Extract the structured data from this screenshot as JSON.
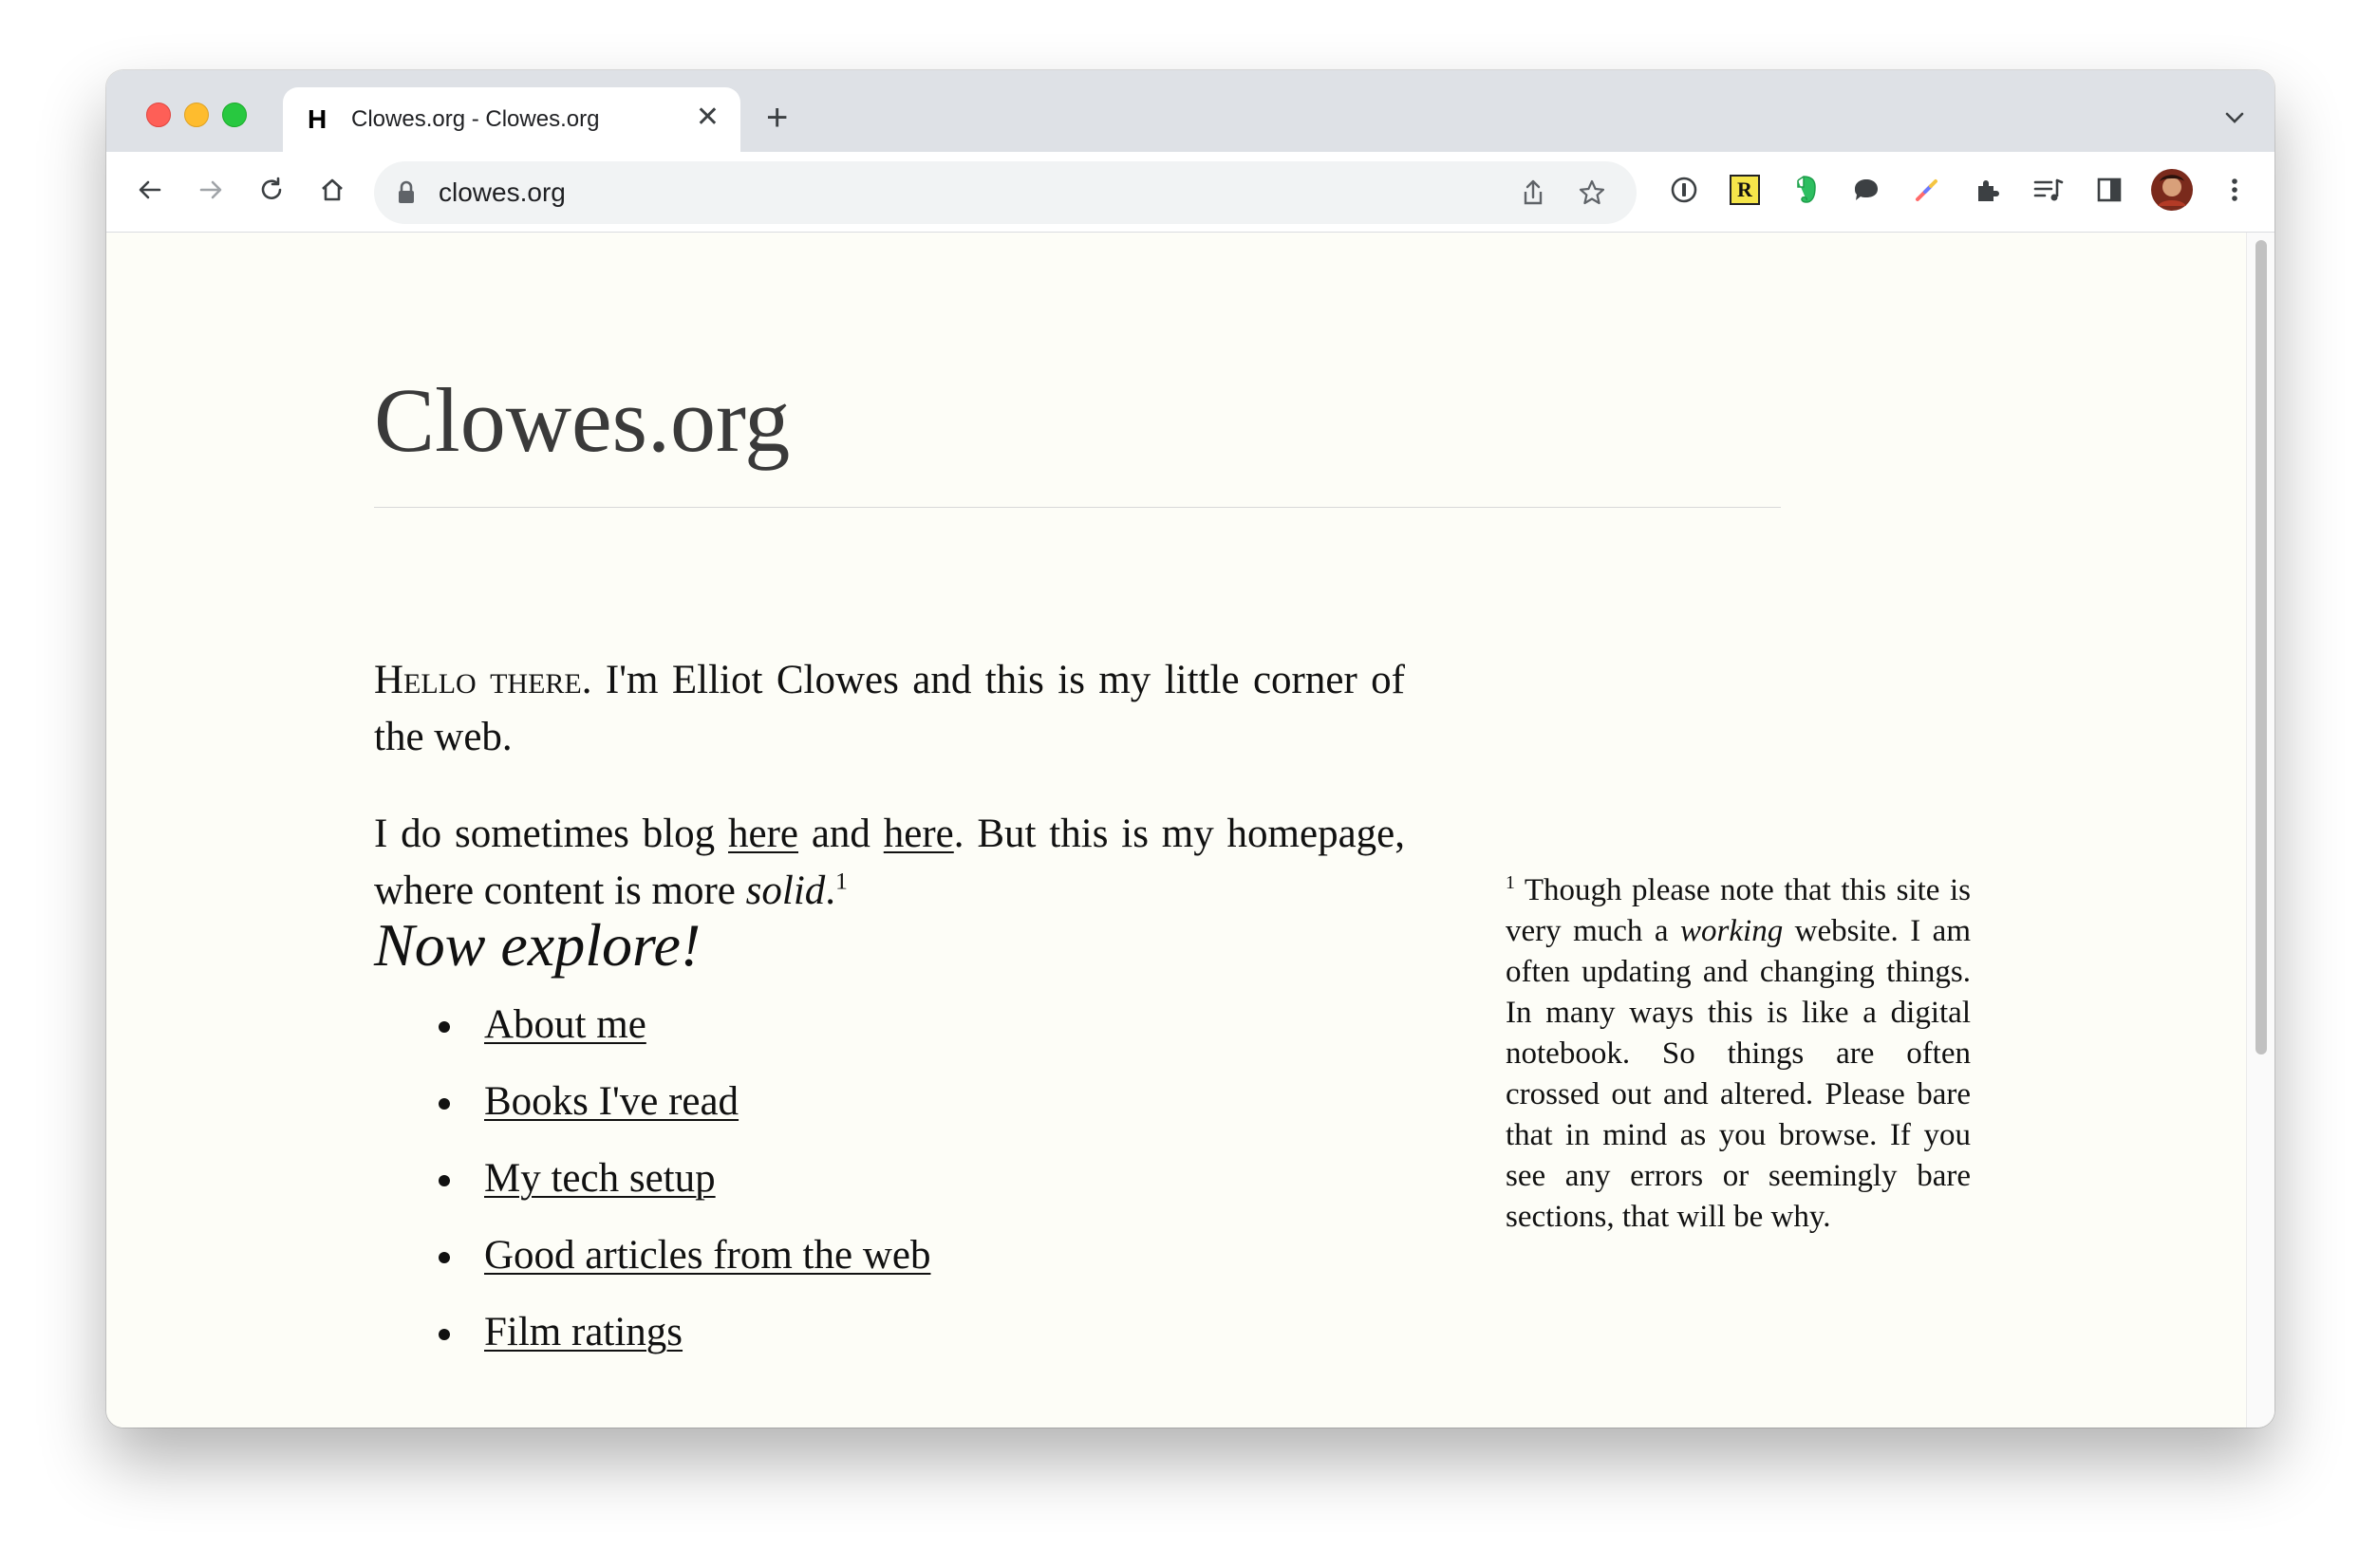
{
  "browser": {
    "tab": {
      "favicon": "H",
      "title": "Clowes.org - Clowes.org",
      "close": "✕"
    },
    "new_tab": "+",
    "tab_menu": "⌄",
    "address": "clowes.org",
    "icons": [
      "back-icon",
      "forward-icon",
      "reload-icon",
      "home-icon",
      "lock-icon",
      "share-icon",
      "bookmark-star-icon",
      "onepassword-icon",
      "readwise-icon",
      "evernote-icon",
      "chat-icon",
      "color-picker-icon",
      "extensions-icon",
      "reading-list-icon",
      "side-panel-icon",
      "profile-avatar",
      "more-menu-icon"
    ],
    "readwise_label": "R"
  },
  "page": {
    "title": "Clowes.org",
    "intro": {
      "lead": "Hello there.",
      "text": " I'm Elliot Clowes and this is my little corner of the web."
    },
    "blog": {
      "t1": "I do sometimes blog ",
      "link1": "here",
      "t2": " and ",
      "link2": "here",
      "t3": ". But this is my homepage, where content is more ",
      "emph": "solid",
      "t4": ".",
      "ref": "1"
    },
    "explore_heading": "Now explore!",
    "links": [
      {
        "label": "About me"
      },
      {
        "label": "Books I've read"
      },
      {
        "label": "My tech setup"
      },
      {
        "label": "Good articles from the web"
      },
      {
        "label": "Film ratings"
      }
    ],
    "sidenote": {
      "ref": "1",
      "t1": " Though please note that this site is very much a ",
      "emph": "working",
      "t2": " website. I am often updating and changing things. In many ways this is like a digital notebook. So things are often crossed out and altered. Please bare that in mind as you browse. If you see any errors or seemingly bare sections, that will be why."
    }
  },
  "colors": {
    "page_background": "#fdfdf7",
    "tabstrip": "#dee1e6",
    "close_light": "#fe5f57",
    "minimize_light": "#febc2e",
    "maximize_light": "#28c840"
  }
}
